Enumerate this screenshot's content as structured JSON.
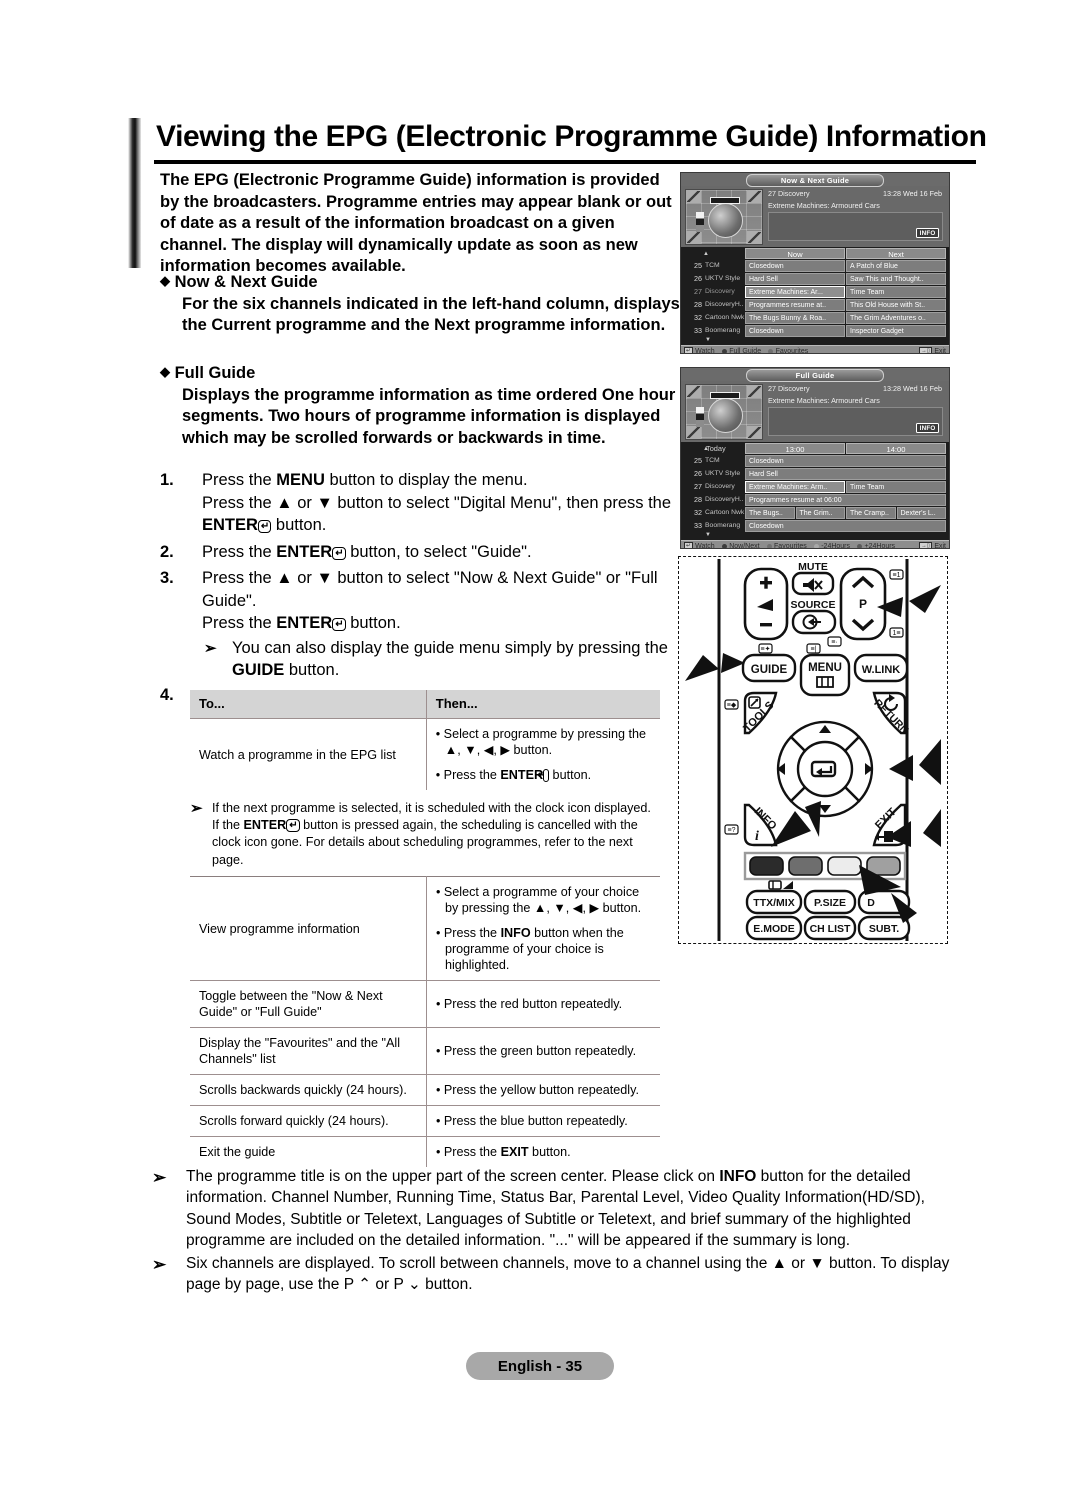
{
  "page": {
    "title": "Viewing the EPG (Electronic Programme Guide) Information",
    "footer_badge": "English - 35"
  },
  "intro": {
    "paragraph": "The EPG (Electronic Programme Guide) information is provided by the broadcasters. Programme entries may appear blank or out of date as a result of the information broadcast on a given channel. The display will dynamically update as soon as new information becomes available."
  },
  "bullets": [
    {
      "heading": "Now & Next Guide",
      "body": "For the six channels indicated in the left-hand column, displays the Current programme and the Next programme information."
    },
    {
      "heading": "Full Guide",
      "body": "Displays the programme information as time ordered One hour segments. Two hours of programme information is displayed which may be scrolled forwards or backwards in time."
    }
  ],
  "steps": {
    "s1_num": "1.",
    "s1_line1_a": "Press the ",
    "s1_line1_b": "MENU",
    "s1_line1_c": " button to display the menu.",
    "s1_line2_a": "Press the ▲ or ▼ button to select \"Digital Menu\", then press the ",
    "s1_line2_b": "ENTER",
    "s1_line2_c": " button.",
    "s2_num": "2.",
    "s2_a": "Press the ",
    "s2_b": "ENTER",
    "s2_c": " button, to select \"Guide\".",
    "s3_num": "3.",
    "s3_line1": "Press the ▲ or ▼ button to select \"Now & Next Guide\" or \"Full Guide\".",
    "s3_line2_a": "Press the ",
    "s3_line2_b": "ENTER",
    "s3_line2_c": " button.",
    "s3_note_a": "You can also display the guide menu simply by pressing the ",
    "s3_note_b": "GUIDE",
    "s3_note_c": " button.",
    "s4_num": "4."
  },
  "table": {
    "headers": [
      "To...",
      "Then..."
    ],
    "row1": {
      "to": "Watch a programme in the EPG list",
      "then_1": "• Select a programme by pressing the ▲, ▼, ◀, ▶ button.",
      "then_2_a": "• Press the ",
      "then_2_b": "ENTER",
      "then_2_c": " button."
    },
    "inline_note": {
      "a": "If the next programme is selected, it is scheduled with the clock icon displayed. If the ",
      "b": "ENTER",
      "c": " button is pressed again, the scheduling is cancelled with the clock icon gone. For details about scheduling programmes, refer to the next page."
    },
    "row2": {
      "to": "View programme information",
      "then_1": "• Select a programme of your choice by pressing the ▲, ▼, ◀, ▶ button.",
      "then_2_a": "• Press the ",
      "then_2_b": "INFO",
      "then_2_c": " button when the programme of your choice is highlighted."
    },
    "row3": {
      "to": "Toggle between the \"Now & Next Guide\" or \"Full Guide\"",
      "then": "• Press the red button repeatedly."
    },
    "row4": {
      "to": "Display the \"Favourites\" and the \"All Channels\" list",
      "then": "• Press the green button repeatedly."
    },
    "row5": {
      "to": "Scrolls backwards quickly (24 hours).",
      "then": "• Press the yellow button repeatedly."
    },
    "row6": {
      "to": "Scrolls forward quickly (24 hours).",
      "then": "• Press the blue button repeatedly."
    },
    "row7": {
      "to": "Exit the guide",
      "then_a": "• Press the ",
      "then_b": "EXIT",
      "then_c": " button."
    }
  },
  "bottom_notes": {
    "note1_a": "The programme title is on the upper part of the screen center. Please click on ",
    "note1_b": "INFO",
    "note1_c": " button for the detailed information. Channel Number, Running Time, Status Bar, Parental Level, Video Quality Information(HD/SD), Sound Modes, Subtitle or Teletext, Languages of Subtitle or Teletext, and brief summary of the highlighted programme are included on the detailed information. \"...\" will be appeared if the summary is long.",
    "note2": "Six channels are displayed. To scroll between channels, move to a channel using the ▲ or ▼ button. To display page by page, use the P ⌃ or P ⌄ button."
  },
  "epg_now_next": {
    "title": "Now & Next Guide",
    "channel": "27 Discovery",
    "programme": "Extreme Machines: Armoured Cars",
    "timestamp": "13:28 Wed 16 Feb",
    "info_button": "INFO",
    "columns": [
      "Now",
      "Next"
    ],
    "rows": [
      {
        "num": "25",
        "name": "TCM",
        "now": "Closedown",
        "next": "A Patch of Blue",
        "selected": false
      },
      {
        "num": "26",
        "name": "UKTV Style",
        "now": "Hard Sell",
        "next": "Saw This and Thought..",
        "selected": false
      },
      {
        "num": "27",
        "name": "Discovery",
        "now": "Extreme Machines: Ar...",
        "next": "Time Team",
        "selected": true
      },
      {
        "num": "28",
        "name": "DiscoveryH..",
        "now": "Programmes resume at..",
        "next": "This Old House with St..",
        "selected": false
      },
      {
        "num": "32",
        "name": "Cartoon Nwk",
        "now": "The Bugs Bunny & Roa..",
        "next": "The Grim Adventures o..",
        "selected": false
      },
      {
        "num": "33",
        "name": "Boomerang",
        "now": "Closedown",
        "next": "Inspector Gadget",
        "selected": false
      }
    ],
    "footer": [
      {
        "key": "enter",
        "label": "Watch"
      },
      {
        "key": "red",
        "label": "Full Guide"
      },
      {
        "key": "green",
        "label": "Favourites"
      },
      {
        "key": "exit",
        "label": "Exit"
      }
    ]
  },
  "epg_full_guide": {
    "title": "Full Guide",
    "channel": "27 Discovery",
    "programme": "Extreme Machines: Armoured Cars",
    "timestamp": "13:28 Wed 16 Feb",
    "info_button": "INFO",
    "day_label": "Today",
    "time_slots": [
      "13:00",
      "14:00"
    ],
    "rows": [
      {
        "num": "25",
        "name": "TCM",
        "cells": [
          {
            "text": "Closedown",
            "span": 2,
            "selected": false
          }
        ]
      },
      {
        "num": "26",
        "name": "UKTV Style",
        "cells": [
          {
            "text": "Hard Sell",
            "span": 2,
            "selected": false
          }
        ]
      },
      {
        "num": "27",
        "name": "Discovery",
        "cells": [
          {
            "text": "Extreme Machines: Arm..",
            "span": 1,
            "selected": true
          },
          {
            "text": "Time Team",
            "span": 1,
            "selected": false
          }
        ]
      },
      {
        "num": "28",
        "name": "DiscoveryH..",
        "cells": [
          {
            "text": "Programmes resume at 06:00",
            "span": 2,
            "selected": false
          }
        ]
      },
      {
        "num": "32",
        "name": "Cartoon Nwk",
        "cells": [
          {
            "text": "The Bugs..",
            "span": 1,
            "selected": false
          },
          {
            "text": "The Grim..",
            "span": 1,
            "selected": false
          },
          {
            "text": "The Cramp..",
            "span": 1,
            "selected": false
          },
          {
            "text": "Dexter's L..",
            "span": 1,
            "selected": false
          }
        ]
      },
      {
        "num": "33",
        "name": "Boomerang",
        "cells": [
          {
            "text": "Closedown",
            "span": 2,
            "selected": false
          }
        ]
      }
    ],
    "footer": [
      {
        "key": "enter",
        "label": "Watch"
      },
      {
        "key": "red",
        "label": "Now/Next"
      },
      {
        "key": "green",
        "label": "Favourites"
      },
      {
        "key": "yellow",
        "label": "-24Hours"
      },
      {
        "key": "blue",
        "label": "+24Hours"
      },
      {
        "key": "exit",
        "label": "Exit"
      }
    ]
  },
  "remote": {
    "mute_label": "MUTE",
    "source_label": "SOURCE",
    "p_label": "P",
    "guide": "GUIDE",
    "menu": "MENU",
    "wlink": "W.LINK",
    "tools": "TOOLS",
    "return": "RETURN",
    "info": "INFO",
    "exit": "EXIT",
    "ttxmix": "TTX/MIX",
    "psize": "P.SIZE",
    "dual": "D",
    "emode": "E.MODE",
    "chlist": "CH LIST",
    "subt": "SUBT."
  }
}
